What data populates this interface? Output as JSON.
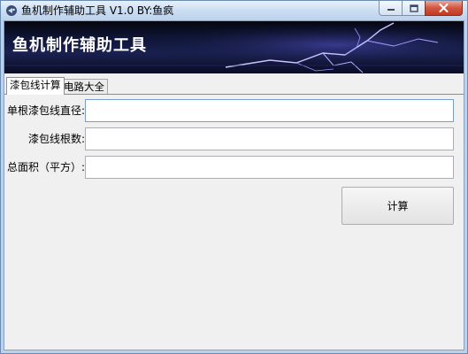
{
  "window": {
    "title": "鱼机制作辅助工具 V1.0  BY:鱼疯"
  },
  "banner": {
    "title": "鱼机制作辅助工具"
  },
  "tabs": [
    {
      "label": "漆包线计算",
      "active": true
    },
    {
      "label": "电路大全",
      "active": false
    }
  ],
  "form": {
    "fields": [
      {
        "label": "单根漆包线直径:",
        "value": ""
      },
      {
        "label": "漆包线根数:",
        "value": ""
      },
      {
        "label": "总面积（平方）:",
        "value": ""
      }
    ],
    "calculate_label": "计算"
  },
  "icons": {
    "app": "app-fish-icon",
    "minimize": "minimize-icon",
    "maximize": "maximize-icon",
    "close": "close-icon"
  },
  "colors": {
    "banner_dark": "#0a0d24",
    "lightning": "#c9c2ff",
    "close_button": "#c23a21"
  }
}
